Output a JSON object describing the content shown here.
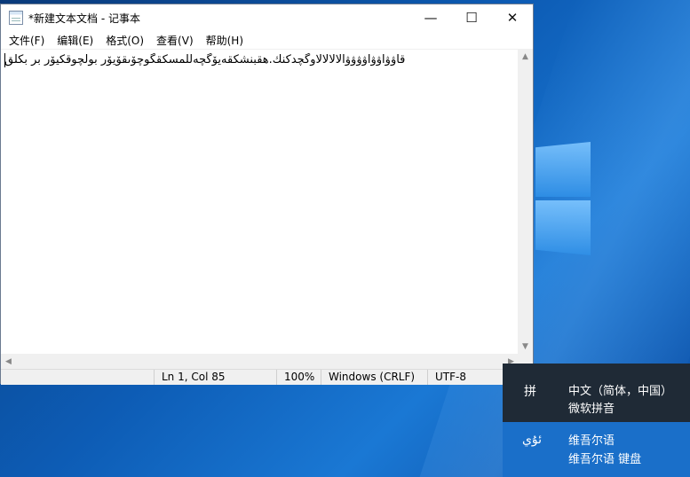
{
  "notepad": {
    "title": "*新建文本文档 - 记事本",
    "menu": [
      "文件(F)",
      "编辑(E)",
      "格式(O)",
      "查看(V)",
      "帮助(H)"
    ],
    "content": "قاۋۋاۋۋاۋۋۋۋالالالالاوگچدكنك.هقبنشكقەيۆگچەللمسكقگوچۆىقۆيۆر بولچوقكيۆر بر بكلق",
    "status": {
      "position": "Ln 1, Col 85",
      "zoom": "100%",
      "line_ending": "Windows (CRLF)",
      "encoding": "UTF-8"
    },
    "controls": {
      "minimize": "—",
      "maximize": "☐",
      "close": "✕"
    }
  },
  "ime": {
    "items": [
      {
        "icon": "拼",
        "line1": "中文（简体，中国）",
        "line2": "微软拼音"
      },
      {
        "icon": "ئۇي",
        "line1": "维吾尔语",
        "line2": "维吾尔语 键盘"
      }
    ]
  }
}
